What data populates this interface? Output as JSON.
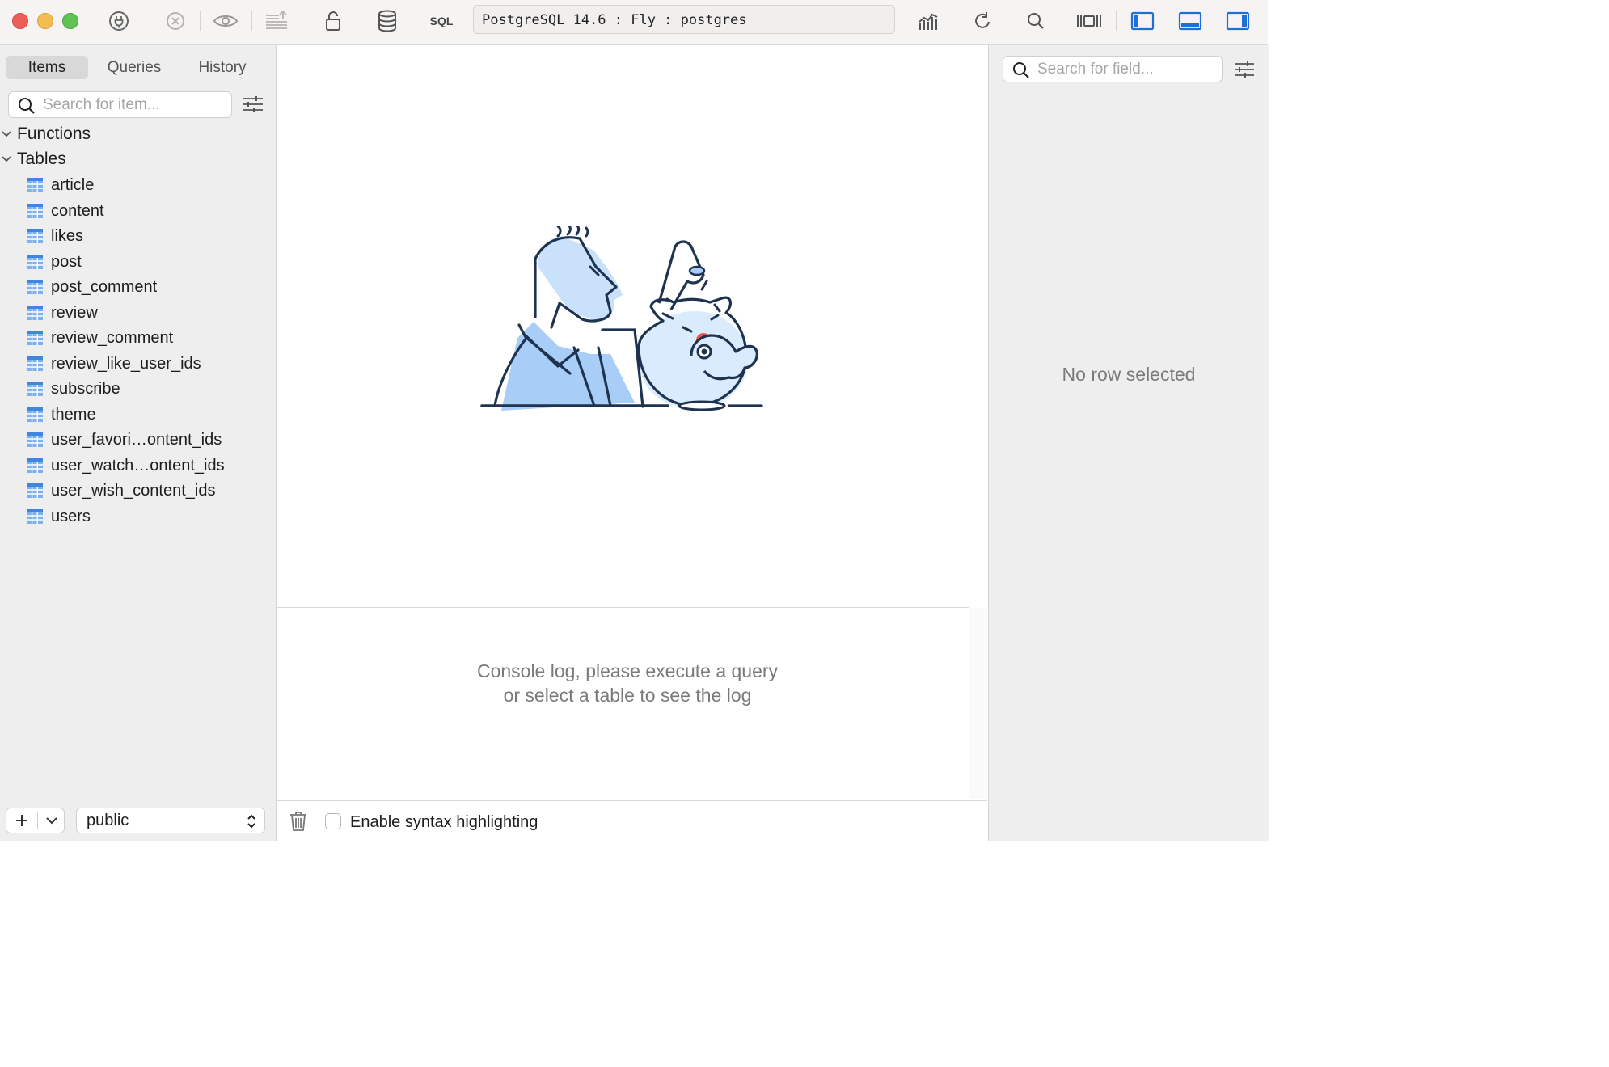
{
  "toolbar": {
    "sql_label": "SQL",
    "connection": "PostgreSQL 14.6 : Fly : postgres",
    "accent": "#1f6fd6"
  },
  "sidebar": {
    "tabs": [
      {
        "label": "Items",
        "active": true
      },
      {
        "label": "Queries",
        "active": false
      },
      {
        "label": "History",
        "active": false
      }
    ],
    "search_placeholder": "Search for item...",
    "groups": [
      {
        "label": "Functions",
        "expanded": true
      },
      {
        "label": "Tables",
        "expanded": true
      }
    ],
    "tables": [
      "article",
      "content",
      "likes",
      "post",
      "post_comment",
      "review",
      "review_comment",
      "review_like_user_ids",
      "subscribe",
      "theme",
      "user_favori…ontent_ids",
      "user_watch…ontent_ids",
      "user_wish_content_ids",
      "users"
    ],
    "schema": "public"
  },
  "console": {
    "line1": "Console log, please execute a query",
    "line2": "or select a table to see the log",
    "syntax_label": "Enable syntax highlighting",
    "syntax_checked": false
  },
  "right_panel": {
    "search_placeholder": "Search for field...",
    "empty_text": "No row selected"
  }
}
